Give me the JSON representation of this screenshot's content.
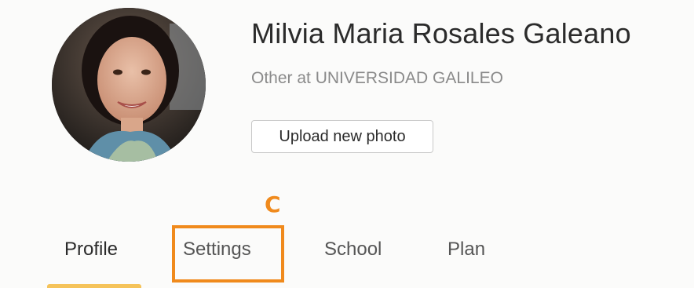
{
  "profile": {
    "name": "Milvia Maria Rosales Galeano",
    "subtitle": "Other at UNIVERSIDAD GALILEO",
    "upload_button_label": "Upload new photo",
    "avatar_icon": "profile-photo"
  },
  "annotation": {
    "letter": "C",
    "color": "#f08a1c"
  },
  "tabs": [
    {
      "label": "Profile",
      "active": true
    },
    {
      "label": "Settings",
      "active": false,
      "highlighted": true
    },
    {
      "label": "School",
      "active": false
    },
    {
      "label": "Plan",
      "active": false
    }
  ],
  "colors": {
    "accent": "#f08a1c",
    "active_tab_indicator": "#f5c35a"
  }
}
